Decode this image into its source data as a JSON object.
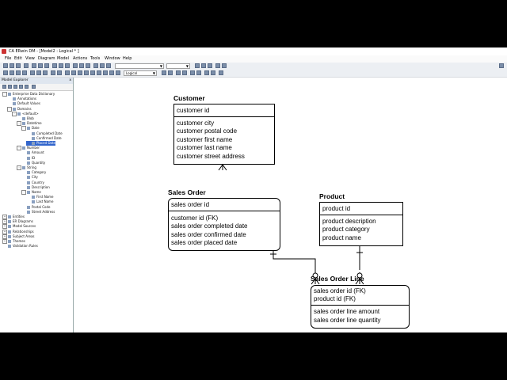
{
  "window": {
    "title": "CA ERwin DM - [Model2 : Logical * ]"
  },
  "menu": [
    "File",
    "Edit",
    "View",
    "Diagram",
    "Model",
    "Actions",
    "Tools",
    "Window",
    "Help"
  ],
  "toolbar": {
    "zoom_combo": "Logical",
    "font_combo": ""
  },
  "explorer": {
    "title": "Model Explorer",
    "close_glyph": "x",
    "tree": [
      {
        "label": "Enterprise Data Dictionary",
        "level": 0,
        "exp": "-"
      },
      {
        "label": "Annotations",
        "level": 1,
        "exp": ""
      },
      {
        "label": "Default Values",
        "level": 1,
        "exp": ""
      },
      {
        "label": "Domains",
        "level": 1,
        "exp": "-"
      },
      {
        "label": "<default>",
        "level": 2,
        "exp": "-"
      },
      {
        "label": "Blob",
        "level": 3,
        "exp": ""
      },
      {
        "label": "Datetime",
        "level": 3,
        "exp": "-"
      },
      {
        "label": "Date",
        "level": 4,
        "exp": "-"
      },
      {
        "label": "Completed Date",
        "level": 5,
        "exp": ""
      },
      {
        "label": "Confirmed Date",
        "level": 5,
        "exp": ""
      },
      {
        "label": "Placed Date",
        "level": 5,
        "exp": "",
        "selected": true
      },
      {
        "label": "Number",
        "level": 3,
        "exp": "-"
      },
      {
        "label": "Amount",
        "level": 4,
        "exp": ""
      },
      {
        "label": "ID",
        "level": 4,
        "exp": ""
      },
      {
        "label": "Quantity",
        "level": 4,
        "exp": ""
      },
      {
        "label": "String",
        "level": 3,
        "exp": "-"
      },
      {
        "label": "Category",
        "level": 4,
        "exp": ""
      },
      {
        "label": "City",
        "level": 4,
        "exp": ""
      },
      {
        "label": "Country",
        "level": 4,
        "exp": ""
      },
      {
        "label": "Description",
        "level": 4,
        "exp": ""
      },
      {
        "label": "Name",
        "level": 4,
        "exp": "-"
      },
      {
        "label": "First Name",
        "level": 5,
        "exp": ""
      },
      {
        "label": "Last Name",
        "level": 5,
        "exp": ""
      },
      {
        "label": "Postal Code",
        "level": 4,
        "exp": ""
      },
      {
        "label": "Street Address",
        "level": 4,
        "exp": ""
      },
      {
        "label": "Entities",
        "level": 0,
        "exp": "+"
      },
      {
        "label": "ER Diagrams",
        "level": 0,
        "exp": "+"
      },
      {
        "label": "Model Sources",
        "level": 0,
        "exp": "+"
      },
      {
        "label": "Relationships",
        "level": 0,
        "exp": "+"
      },
      {
        "label": "Subject Areas",
        "level": 0,
        "exp": "+"
      },
      {
        "label": "Themes",
        "level": 0,
        "exp": "+"
      },
      {
        "label": "Validation Rules",
        "level": 0,
        "exp": ""
      }
    ]
  },
  "entities": {
    "customer": {
      "name": "Customer",
      "keys": [
        "customer id"
      ],
      "attrs": [
        "customer city",
        "customer postal code",
        "customer first name",
        "customer last name",
        "customer street address"
      ]
    },
    "sales_order": {
      "name": "Sales Order",
      "keys": [
        "sales order id"
      ],
      "attrs": [
        "customer id (FK)",
        "sales order completed date",
        "sales order confirmed date",
        "sales order placed date"
      ]
    },
    "product": {
      "name": "Product",
      "keys": [
        "product id"
      ],
      "attrs": [
        "product description",
        "product category",
        "product name"
      ]
    },
    "sales_order_line": {
      "name": "Sales Order Line",
      "keys": [
        "sales order id (FK)",
        "product id (FK)"
      ],
      "attrs": [
        "sales order line amount",
        "sales order line quantity"
      ]
    }
  }
}
